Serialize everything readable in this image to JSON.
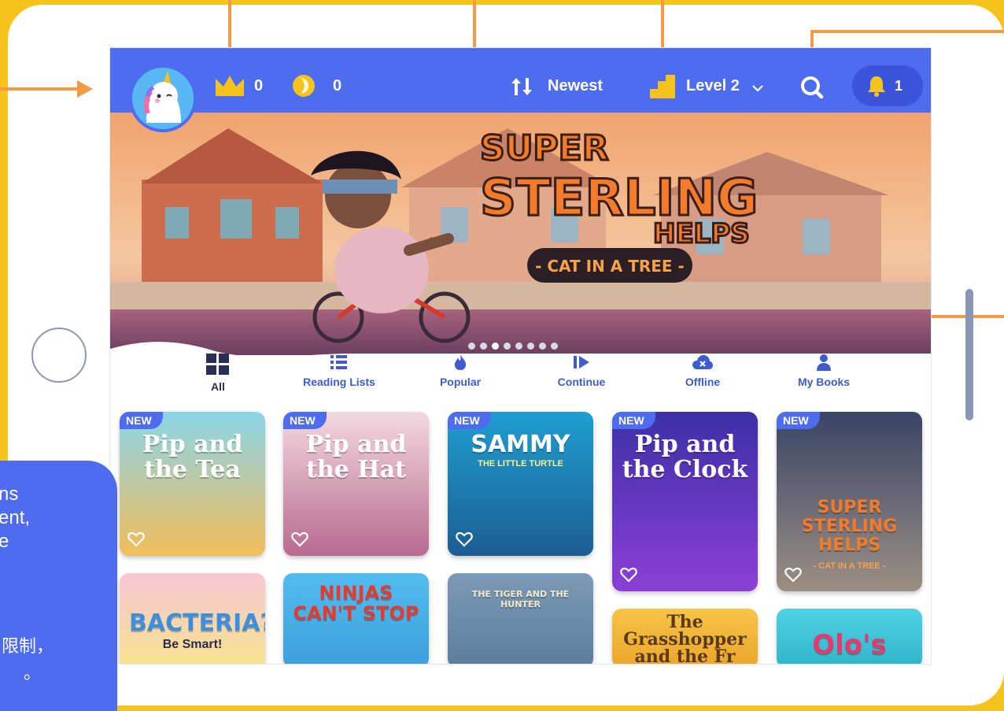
{
  "colors": {
    "brand": "#4e6cf0",
    "frame": "#f7c21c",
    "annotation_arrow": "#f39a45",
    "crown": "#f7c21c"
  },
  "topbar": {
    "crowns": "0",
    "coins": "0",
    "sort_label": "Newest",
    "level_label": "Level 2",
    "notifications": "1",
    "icons": [
      "avatar",
      "crown-icon",
      "coin-icon",
      "sort-icon",
      "level-icon",
      "chevron-down-icon",
      "search-icon",
      "bell-icon"
    ]
  },
  "banner": {
    "title_line1": "SUPER",
    "title_line2": "STERLING",
    "title_line3": "HELPS",
    "subtitle": "- CAT IN A TREE -",
    "slide_count": 8,
    "active_slide": 3
  },
  "tabs": [
    {
      "label": "All",
      "icon": "grid-icon"
    },
    {
      "label": "Reading Lists",
      "icon": "list-icon"
    },
    {
      "label": "Popular",
      "icon": "flame-icon"
    },
    {
      "label": "Continue",
      "icon": "play-icon"
    },
    {
      "label": "Offline",
      "icon": "cloud-icon"
    },
    {
      "label": "My Books",
      "icon": "person-icon"
    }
  ],
  "books": [
    {
      "badge": "NEW",
      "title": "Pip and the Tea",
      "subtitle": ""
    },
    {
      "badge": "NEW",
      "title": "Pip and the Hat",
      "subtitle": ""
    },
    {
      "badge": "NEW",
      "title": "SAMMY",
      "subtitle": "THE LITTLE TURTLE"
    },
    {
      "badge": "NEW",
      "title": "Pip and the Clock",
      "subtitle": ""
    },
    {
      "badge": "NEW",
      "title": "SUPER STERLING HELPS",
      "subtitle": "- CAT IN A TREE -"
    },
    {
      "badge": "",
      "title": "BACTERIA?",
      "subtitle": "Be Smart!"
    },
    {
      "badge": "",
      "title": "NINJAS CAN'T STOP",
      "subtitle": ""
    },
    {
      "badge": "",
      "title": "THE TIGER AND THE HUNTER",
      "subtitle": ""
    },
    {
      "badge": "",
      "title": "The Grasshopper and the Fr",
      "subtitle": ""
    },
    {
      "badge": "",
      "title": "Olo's",
      "subtitle": ""
    }
  ],
  "side_note": {
    "line1": "ns",
    "line2": "ent,",
    "line3": "e",
    "line4": "限制，",
    "line5": "。"
  }
}
